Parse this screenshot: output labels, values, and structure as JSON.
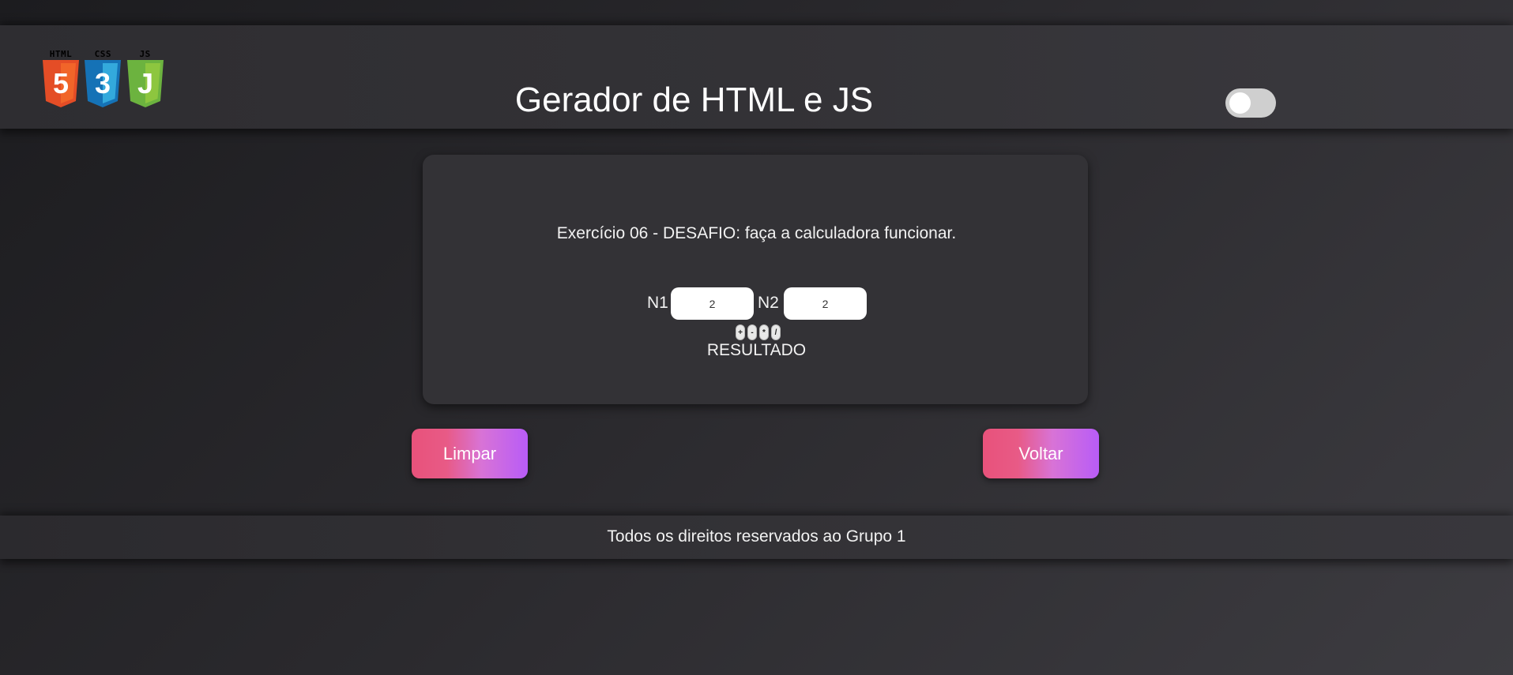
{
  "header": {
    "title": "Gerador de HTML e JS",
    "logos": [
      {
        "caption": "HTML",
        "glyph": "5",
        "icon": "html5-shield-icon",
        "color": "#e44d26",
        "shade": "#f16529"
      },
      {
        "caption": "CSS",
        "glyph": "3",
        "icon": "css3-shield-icon",
        "color": "#1572b6",
        "shade": "#33a9dc"
      },
      {
        "caption": "JS",
        "glyph": "J",
        "icon": "js-shield-icon",
        "color": "#6cb33f",
        "shade": "#8dc63f"
      }
    ],
    "theme_toggle": {
      "state": "off"
    }
  },
  "card": {
    "exercise_title": "Exercício 06 - DESAFIO: faça a calculadora funcionar.",
    "n1_label": "N1",
    "n1_value": "2",
    "n2_label": "N2",
    "n2_value": "2",
    "operators": [
      "+",
      "-",
      "*",
      "/"
    ],
    "result_label": "RESULTADO"
  },
  "actions": {
    "clear_label": "Limpar",
    "back_label": "Voltar"
  },
  "footer": {
    "text": "Todos os direitos reservados ao Grupo 1"
  },
  "colors": {
    "button_gradient_start": "#e8527b",
    "button_gradient_end": "#b85cf7",
    "card_bg": "#333236"
  }
}
